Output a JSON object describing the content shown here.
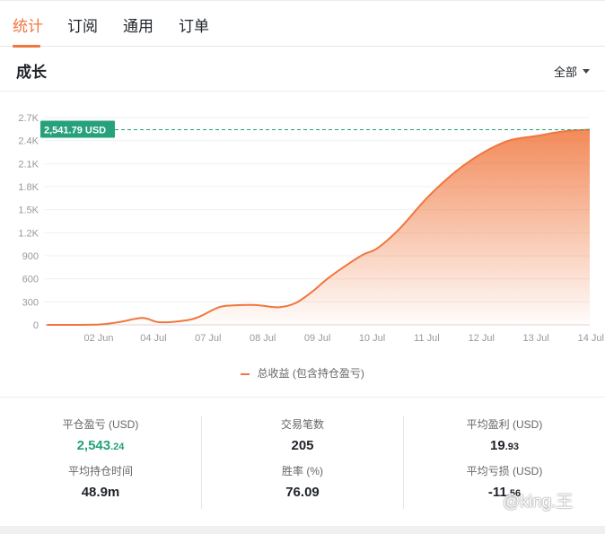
{
  "tabs": [
    {
      "label": "统计",
      "active": true
    },
    {
      "label": "订阅",
      "active": false
    },
    {
      "label": "通用",
      "active": false
    },
    {
      "label": "订单",
      "active": false
    }
  ],
  "section": {
    "title": "成长",
    "range_select": "全部"
  },
  "chart_data": {
    "type": "area",
    "y_ticks": [
      "0",
      "300",
      "600",
      "900",
      "1.2K",
      "1.5K",
      "1.8K",
      "2.1K",
      "2.4K",
      "2.7K"
    ],
    "x_ticks": [
      "02 Jun",
      "04 Jul",
      "07 Jul",
      "08 Jul",
      "09 Jul",
      "10 Jul",
      "11 Jul",
      "12 Jul",
      "13 Jul",
      "14 Jul"
    ],
    "ylim": [
      0,
      2700
    ],
    "grid": true,
    "series": [
      {
        "name": "总收益 (包含持仓盈亏)",
        "color": "#f0763d",
        "x_index": [
          -0.95,
          0,
          0.4,
          0.8,
          1.1,
          1.5,
          1.8,
          2.2,
          2.5,
          2.8,
          3.0,
          3.3,
          3.6,
          3.9,
          4.2,
          4.6,
          4.85,
          5.1,
          5.5,
          6.0,
          6.5,
          7.0,
          7.5,
          8.0,
          8.5,
          9.0
        ],
        "values": [
          0,
          5,
          40,
          90,
          35,
          50,
          95,
          230,
          255,
          260,
          250,
          230,
          285,
          430,
          610,
          810,
          920,
          1000,
          1250,
          1650,
          1980,
          2230,
          2400,
          2460,
          2520,
          2541.79
        ]
      }
    ],
    "marker_label": "2,541.79 USD",
    "marker_value": 2541.79
  },
  "legend": {
    "label": "总收益 (包含持仓盈亏)",
    "color": "#f0763d"
  },
  "stats": {
    "closed_pnl": {
      "label": "平仓盈亏 (USD)",
      "main": "2,543",
      "decimal": ".24"
    },
    "avg_hold": {
      "label": "平均持仓时间",
      "value": "48.9m"
    },
    "trade_count": {
      "label": "交易笔数",
      "value": "205"
    },
    "win_rate": {
      "label": "胜率 (%)",
      "value": "76.09"
    },
    "avg_profit": {
      "label": "平均盈利 (USD)",
      "main": "19",
      "decimal": ".93"
    },
    "avg_loss": {
      "label": "平均亏损 (USD)",
      "main": "-11",
      "decimal": ".56"
    }
  },
  "watermark": "@king.王",
  "colors": {
    "accent": "#f0763d",
    "positive": "#26a17b",
    "marker_bg": "#26a17b"
  }
}
